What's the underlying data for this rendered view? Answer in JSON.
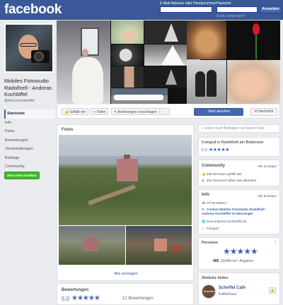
{
  "topbar": {
    "logo": "facebook",
    "email_label": "E-Mail-Adresse oder Handynummer",
    "password_label": "Passwort",
    "login_button": "Anmelden",
    "forgot_link": "Konto vergessen?"
  },
  "profile": {
    "name": "Mobiles Fotostudio Radolfzell - Andreas Kochlöffel",
    "handle": "@foto.kochloeffel"
  },
  "left_nav": {
    "items": [
      "Startseite",
      "Info",
      "Fotos",
      "Bewertungen",
      "Veranstaltungen",
      "Beiträge",
      "Community"
    ],
    "create_button": "Eine Seite erstellen"
  },
  "actions": {
    "like": "Gefällt mir",
    "share": "Teilen",
    "suggest": "Änderungen vorschlagen",
    "more": "···",
    "call": "Jetzt anrufen",
    "message": "Nachricht"
  },
  "photos": {
    "title": "Fotos",
    "see_all": "Alle anzeigen"
  },
  "reviews": {
    "title": "Bewertungen",
    "score": "5.0",
    "stars": "★★★★★",
    "count": "12 Bewertungen"
  },
  "sidebar": {
    "search_placeholder": "Suche nach Beiträgen auf dieser Seite",
    "about_text": "Fotograf in Radolfzell am Bodensee",
    "about_score": "5.0",
    "about_stars": "★★★★★",
    "community": {
      "title": "Community",
      "see_all": "Alle anzeigen",
      "likes": "405 Personen gefällt das",
      "follows": "404 Personen haben das abonniert"
    },
    "info": {
      "title": "Info",
      "see_all": "Alle anzeigen",
      "phone": "07732 918817",
      "messenger": "Contact Mobiles Fotostudio Radolfzell - Andreas Kochlöffel on Messenger",
      "website": "www.andreas-kochloeffel.de",
      "category": "Fotograf"
    },
    "people": {
      "title": "Personen",
      "stars": "★★★★★",
      "count": "405",
      "suffix": "„Gefällt mir“-Angaben"
    },
    "similar": {
      "title": "Ähnliche Seiten",
      "logo_text": "Scheffel",
      "name": "Scheffel Café",
      "category": "Kaffeehaus",
      "like": "👍"
    }
  },
  "colors": {
    "brand": "#3b5998",
    "button_blue": "#4267b2",
    "create_green": "#42b72a",
    "link": "#385898"
  }
}
